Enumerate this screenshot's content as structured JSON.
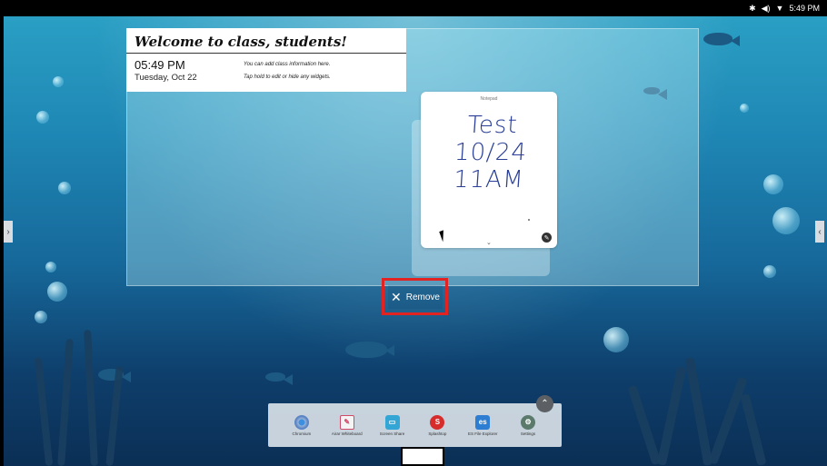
{
  "status_bar": {
    "icons": [
      "bluetooth-icon",
      "volume-icon",
      "wifi-icon"
    ],
    "time": "5:49 PM"
  },
  "welcome_widget": {
    "title": "Welcome to class, students!",
    "time": "05:49 PM",
    "date": "Tuesday, Oct 22",
    "hint_line_1": "You can add class information here.",
    "hint_line_2": "Tap hold to edit or hide any widgets."
  },
  "notepad_widget": {
    "title": "Notepad",
    "line_1": "Test 10/24",
    "line_2": "11AM"
  },
  "remove_button": {
    "label": "Remove"
  },
  "dock": {
    "apps": [
      {
        "label": "Chromium",
        "icon": "chromium-icon"
      },
      {
        "label": "Airar Whiteboard",
        "icon": "whiteboard-icon"
      },
      {
        "label": "Screen Share",
        "icon": "screen-share-icon"
      },
      {
        "label": "Splashtop",
        "icon": "splashtop-icon"
      },
      {
        "label": "ES File Explorer",
        "icon": "es-file-explorer-icon"
      },
      {
        "label": "Settings",
        "icon": "settings-icon"
      }
    ]
  },
  "colors": {
    "highlight": "#e32222",
    "wallpaper_top": "#2a9fc4",
    "wallpaper_bottom": "#0b2f55",
    "handwriting": "#2a3f95"
  }
}
